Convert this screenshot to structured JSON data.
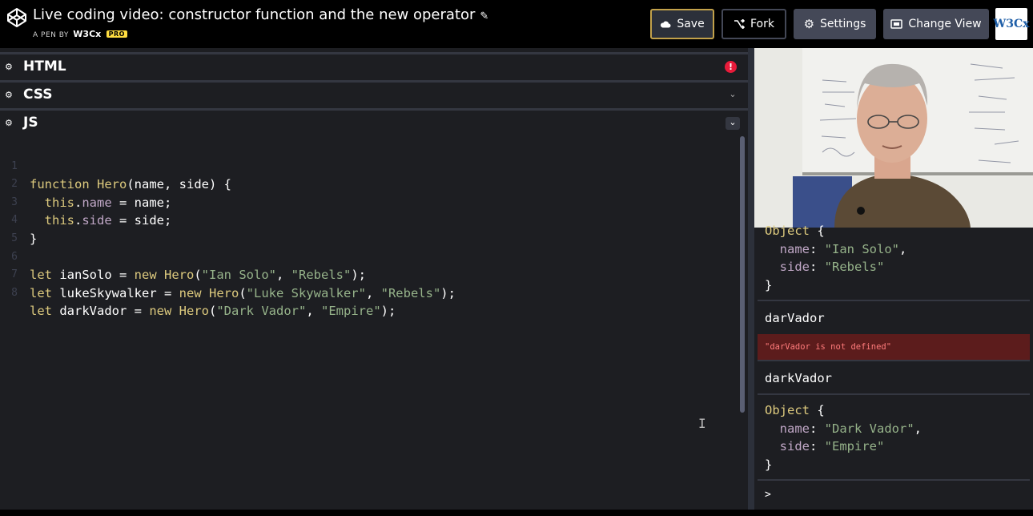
{
  "header": {
    "title": "Live coding video: constructor function and the new operator",
    "byline_prefix": "A PEN BY",
    "author": "W3Cx",
    "badge": "PRO",
    "buttons": {
      "save": "Save",
      "fork": "Fork",
      "settings": "Settings",
      "change_view": "Change View"
    },
    "avatar_text": "W3Cx"
  },
  "panes": {
    "html": "HTML",
    "css": "CSS",
    "js": "JS",
    "html_error_glyph": "!"
  },
  "code": {
    "line_numbers": [
      "1",
      "2",
      "3",
      "4",
      "5",
      "6",
      "7",
      "8"
    ],
    "lines": [
      [
        "function",
        "Hero",
        "(name, side) {"
      ],
      [
        "this",
        ".",
        "name",
        " = name;"
      ],
      [
        "this",
        ".",
        "side",
        " = side;"
      ],
      [
        "}"
      ],
      [
        ""
      ],
      [
        "let",
        " ianSolo = ",
        "new",
        " ",
        "Hero",
        "(",
        "\"Ian Solo\"",
        ", ",
        "\"Rebels\"",
        ");"
      ],
      [
        "let",
        " lukeSkywalker = ",
        "new",
        " ",
        "Hero",
        "(",
        "\"Luke Skywalker\"",
        ", ",
        "\"Rebels\"",
        ");"
      ],
      [
        "let",
        " darkVador = ",
        "new",
        " ",
        "Hero",
        "(",
        "\"Dark Vador\"",
        ", ",
        "\"Empire\"",
        ");"
      ]
    ]
  },
  "console": {
    "obj1": {
      "head": "Object",
      "brace_open": " {",
      "k1": "name",
      "v1": "\"Ian Solo\"",
      "k2": "side",
      "v2": "\"Rebels\"",
      "brace_close": "}"
    },
    "cmd1": "darVador",
    "error1": "\"darVador is not defined\"",
    "cmd2": "darkVador",
    "obj2": {
      "head": "Object",
      "brace_open": " {",
      "k1": "name",
      "v1": "\"Dark Vador\"",
      "k2": "side",
      "v2": "\"Empire\"",
      "brace_close": "}"
    },
    "prompt": ">"
  },
  "colors": {
    "topbar": "#000000",
    "editor_bg": "#1d1e22",
    "keyword": "#ddca7e",
    "property": "#c0a7c6",
    "string": "#96b38a",
    "error_bg": "#5c1c1c",
    "save_border": "#c2a14a"
  },
  "icons": [
    "codepen-logo-icon",
    "pencil-icon",
    "cloud-icon",
    "fork-icon",
    "gear-icon",
    "change-view-icon",
    "chevron-down-icon",
    "error-icon",
    "text-cursor-icon"
  ]
}
